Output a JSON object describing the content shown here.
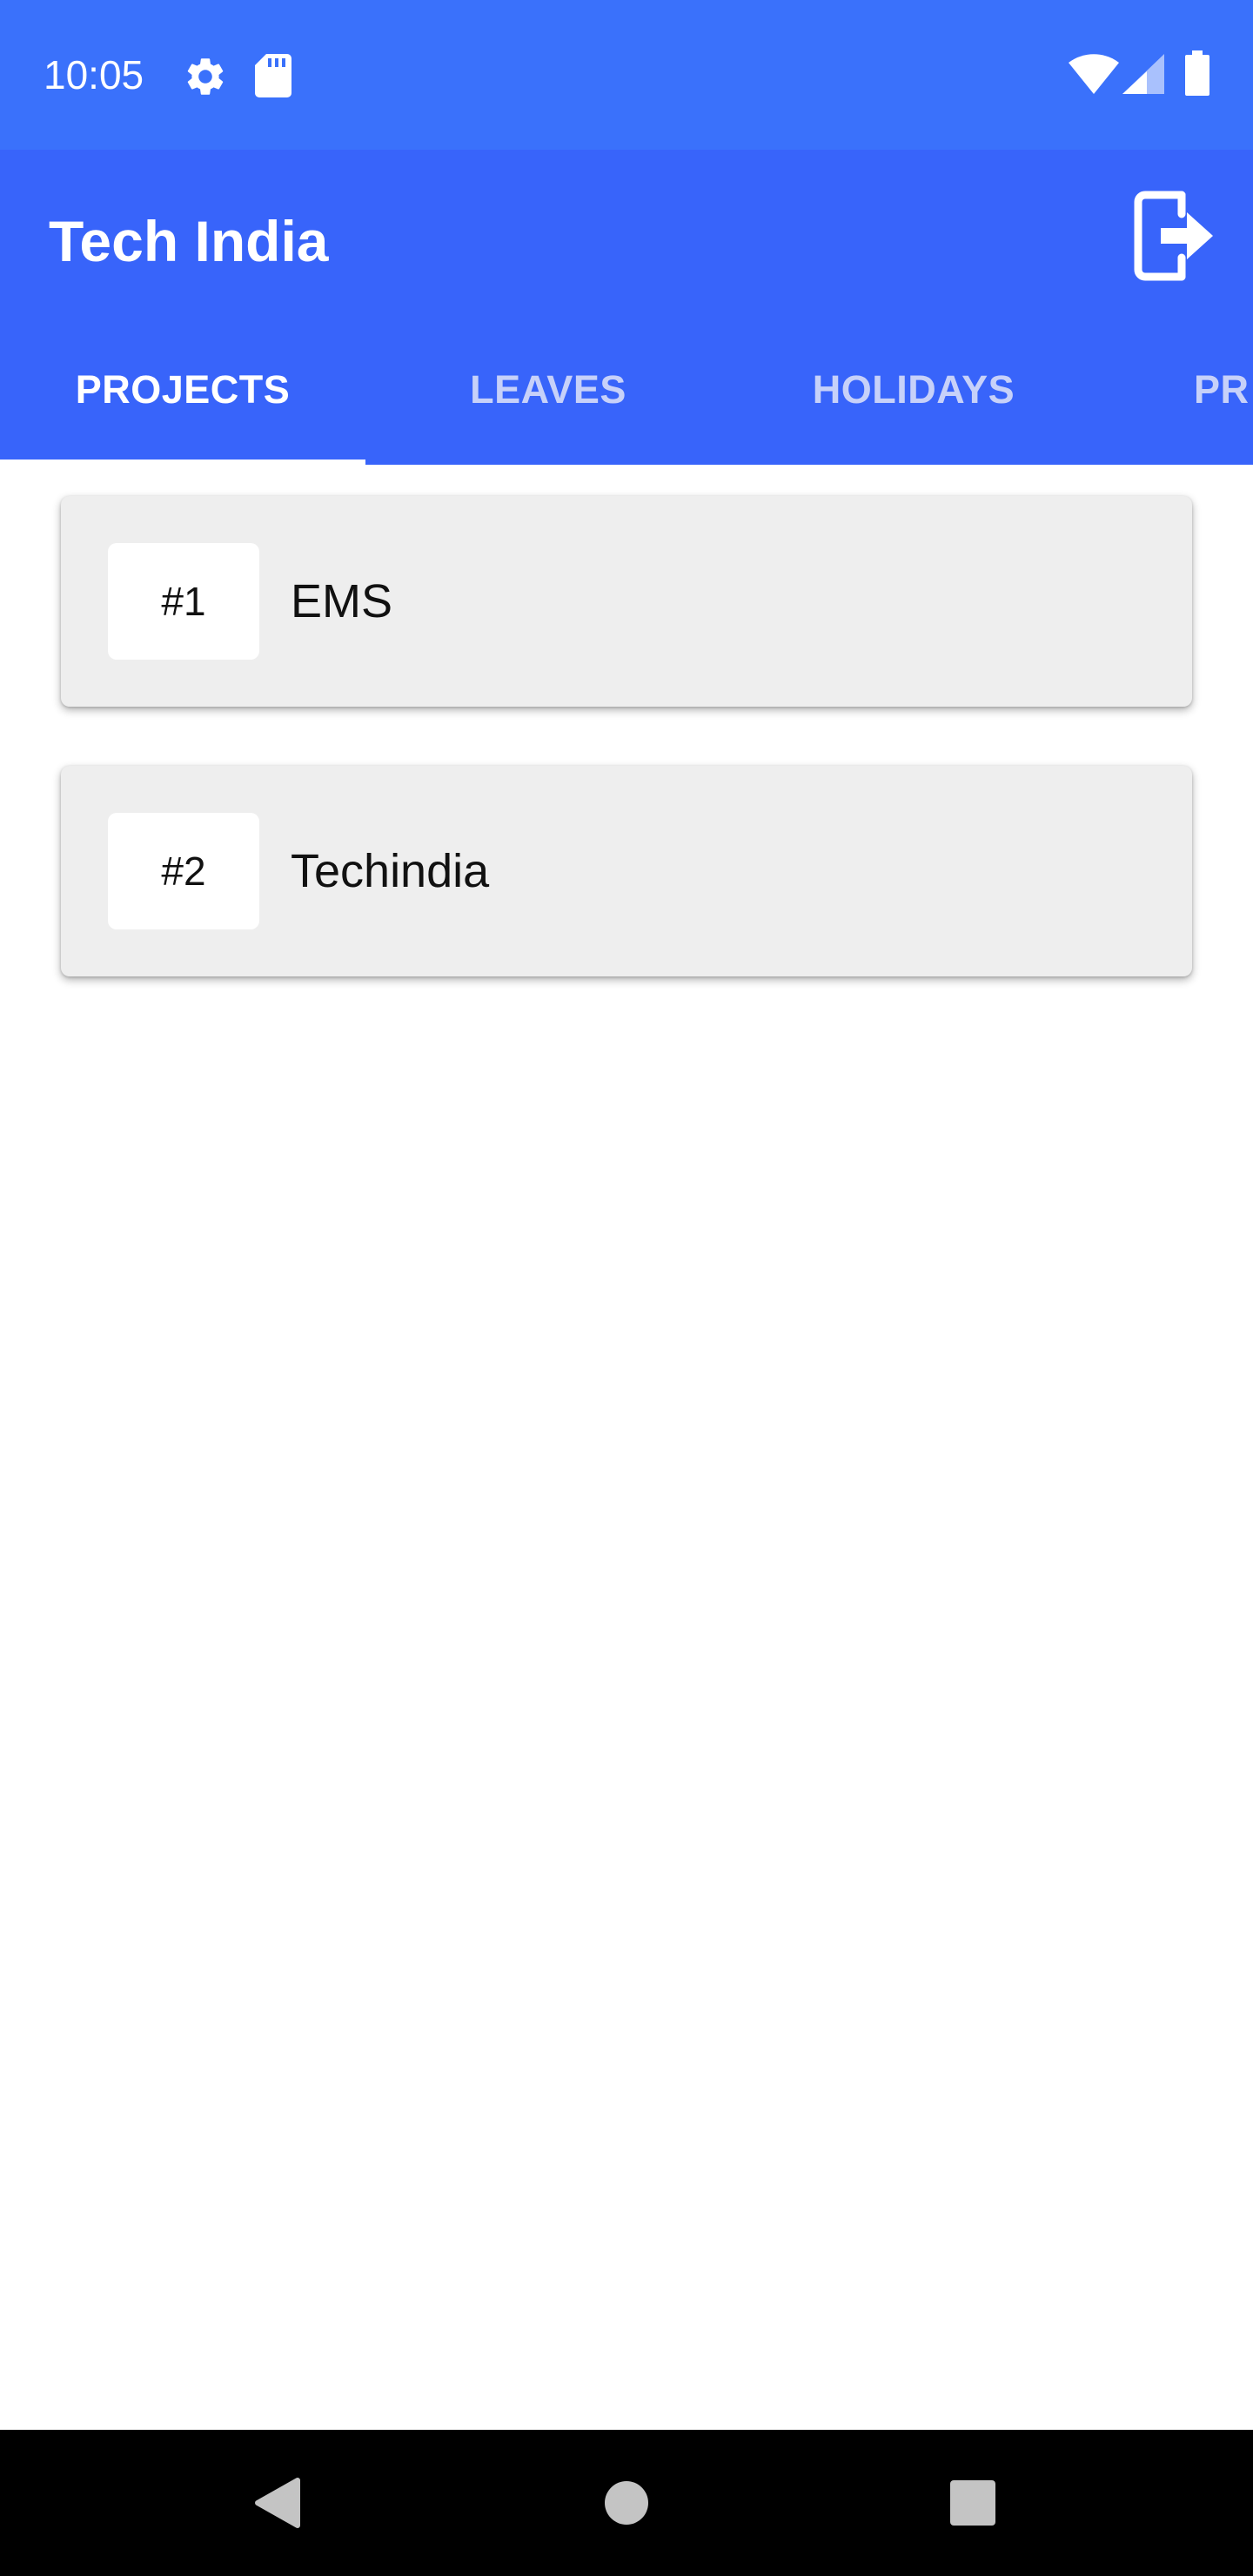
{
  "status_bar": {
    "time": "10:05",
    "background_color": "#3a71fb",
    "icons": [
      "gear-icon",
      "sd-card-icon",
      "wifi-icon",
      "cell-signal-icon",
      "battery-icon"
    ]
  },
  "app_bar": {
    "title": "Tech India",
    "background_color": "#3864fa",
    "logout_icon": "logout-icon"
  },
  "tabs": [
    {
      "label": "PROJECTS",
      "active": true
    },
    {
      "label": "LEAVES",
      "active": false
    },
    {
      "label": "HOLIDAYS",
      "active": false
    },
    {
      "label": "PR",
      "active": false
    }
  ],
  "projects": [
    {
      "number": "#1",
      "name": "EMS"
    },
    {
      "number": "#2",
      "name": "Techindia"
    }
  ],
  "nav_bar": {
    "buttons": [
      "back-icon",
      "home-icon",
      "recents-icon"
    ]
  }
}
